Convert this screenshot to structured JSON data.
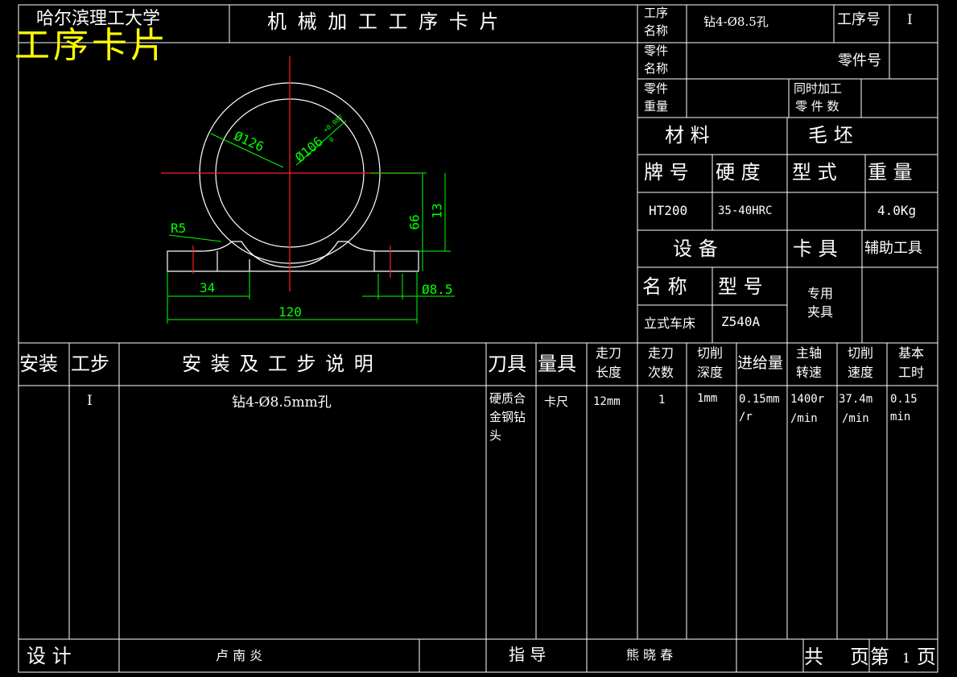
{
  "header": {
    "university": "哈尔滨理工大学",
    "overlay_title": "工序卡片",
    "card_title": "机 械 加 工 工 序 卡 片",
    "process_name_label_1": "工序",
    "process_name_label_2": "名称",
    "process_name_value": "钻4-Ø8.5孔",
    "process_no_label": "工序号",
    "process_no_value": "I",
    "part_name_label_1": "零件",
    "part_name_label_2": "名称",
    "part_no_label": "零件号",
    "part_weight_label_1": "零件",
    "part_weight_label_2": "重量",
    "simul_label_1": "同时加工",
    "simul_label_2": "零 件 数"
  },
  "material": {
    "material_label": "材    料",
    "blank_label": "毛    坯",
    "grade_label": "牌 号",
    "hardness_label": "硬 度",
    "form_label": "型 式",
    "weight_label": "重 量",
    "grade_value": "HT200",
    "hardness_value": "35-40HRC",
    "form_value": "",
    "weight_value": "4.0Kg"
  },
  "equipment": {
    "equipment_label": "设    备",
    "fixture_label": "卡 具",
    "aux_tool_label": "辅助工具",
    "name_label": "名 称",
    "model_label": "型 号",
    "fixture_value_1": "专用",
    "fixture_value_2": "夹具",
    "name_value": "立式车床",
    "model_value": "Z540A"
  },
  "drawing": {
    "dim_outer": "Ø126",
    "dim_inner": "Ø106",
    "tol_upper": "+0.087",
    "tol_lower": "0",
    "dim_radius": "R5",
    "dim_34": "34",
    "dim_120": "120",
    "dim_66": "66",
    "dim_13": "13",
    "dim_hole": "Ø8.5"
  },
  "table": {
    "headers": {
      "install": "安装",
      "step": "工步",
      "description": "安 装 及 工 步 说 明",
      "tool": "刀具",
      "gauge": "量具",
      "stroke_len_1": "走刀",
      "stroke_len_2": "长度",
      "stroke_cnt_1": "走刀",
      "stroke_cnt_2": "次数",
      "depth_1": "切削",
      "depth_2": "深度",
      "feed": "进给量",
      "spindle_1": "主轴",
      "spindle_2": "转速",
      "speed_1": "切削",
      "speed_2": "速度",
      "basic_time_1": "基本",
      "basic_time_2": "工时"
    },
    "row": {
      "step": "I",
      "description": "钻4-Ø8.5mm孔",
      "tool_1": "硬质合",
      "tool_2": "金钢钻",
      "tool_3": "头",
      "gauge": "卡尺",
      "stroke_len": "12mm",
      "stroke_cnt": "1",
      "depth": "1mm",
      "feed_1": "0.15mm",
      "feed_2": "/r",
      "spindle_1": "1400r",
      "spindle_2": "/min",
      "speed_1": "37.4m",
      "speed_2": "/min",
      "time_1": "0.15",
      "time_2": "min"
    }
  },
  "footer": {
    "design_label": "设    计",
    "designer": "卢  南  炎",
    "guide_label": "指    导",
    "guide_name": "熊 晓 春",
    "total_label": "共",
    "pages_label": "页",
    "page_no_label": "第",
    "page_no": "1",
    "page_label": "页"
  },
  "colors": {
    "background": "#000000",
    "lines": "#ffffff",
    "dim": "#00ff00",
    "center": "#ff0000",
    "watermark": "#ffff00"
  }
}
